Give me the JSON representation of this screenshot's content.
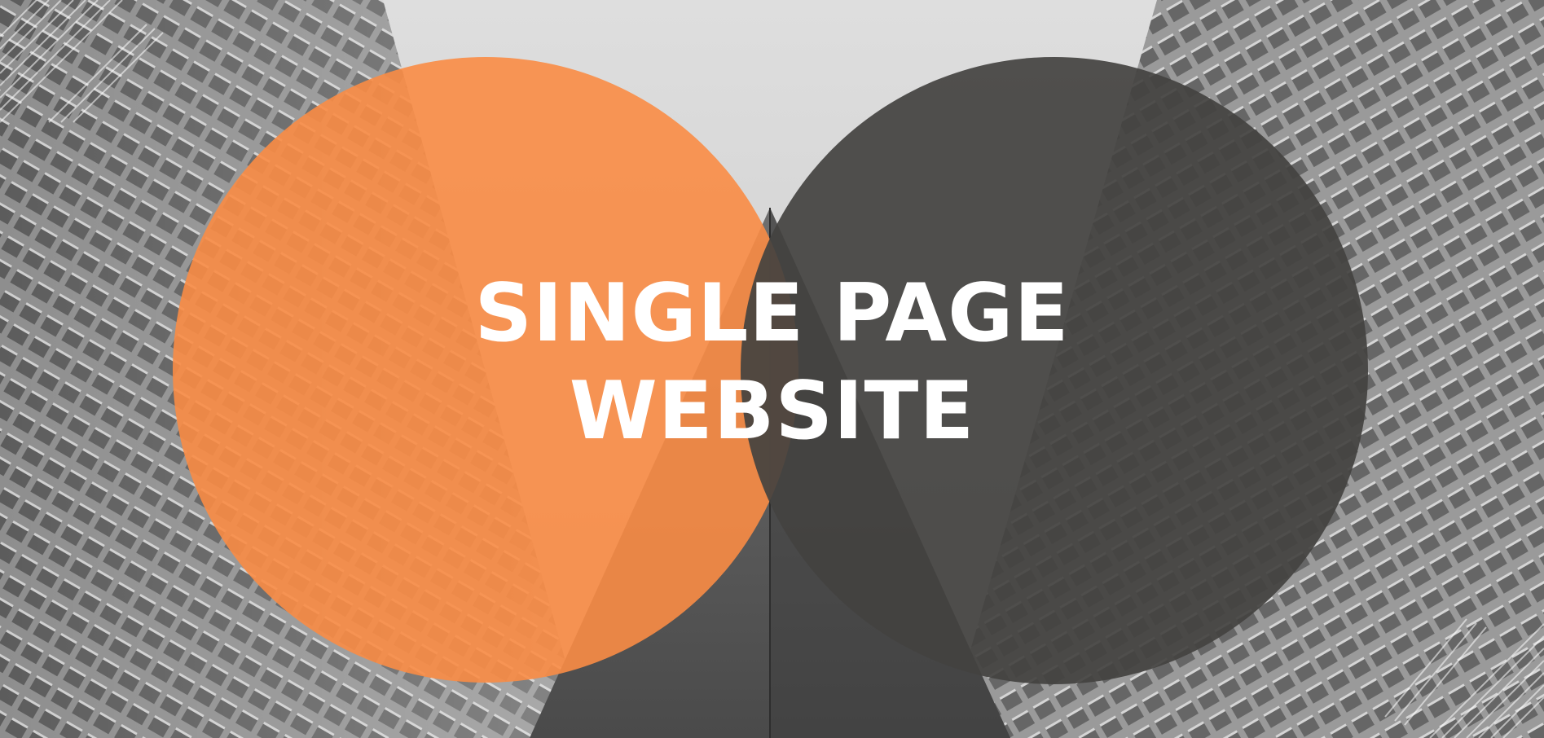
{
  "hero": {
    "title_line_1": "SINGLE PAGE",
    "title_line_2": "WEBSITE"
  },
  "colors": {
    "orange_circle": "#fa8c45",
    "dark_circle": "#434240",
    "title_text": "#ffffff"
  },
  "background": {
    "subject": "grayscale skyscrapers viewed from below"
  }
}
